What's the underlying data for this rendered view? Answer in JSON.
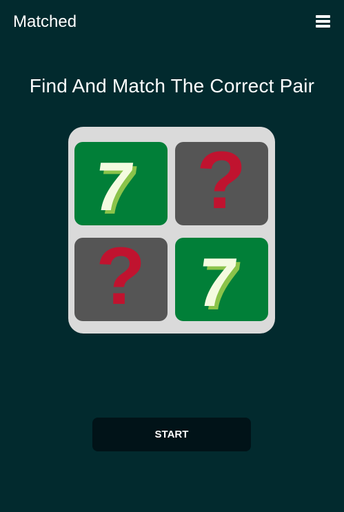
{
  "header": {
    "title": "Matched",
    "menu_icon": "hamburger-menu-icon"
  },
  "main": {
    "heading": "Find And Match The Correct Pair",
    "board": {
      "cards": [
        {
          "state": "revealed",
          "symbol": "7",
          "icon": "seven-icon"
        },
        {
          "state": "hidden",
          "symbol": "?",
          "icon": "question-mark-icon"
        },
        {
          "state": "hidden",
          "symbol": "?",
          "icon": "question-mark-icon"
        },
        {
          "state": "revealed",
          "symbol": "7",
          "icon": "seven-icon"
        }
      ]
    },
    "start_label": "START"
  },
  "colors": {
    "background": "#022a2e",
    "board": "#dadada",
    "card_revealed": "#017f38",
    "card_hidden": "#555555",
    "question_mark": "#c0132f",
    "seven_face": "#f4fbe0",
    "seven_shade": "#8bc34a",
    "start_button": "#011318"
  }
}
